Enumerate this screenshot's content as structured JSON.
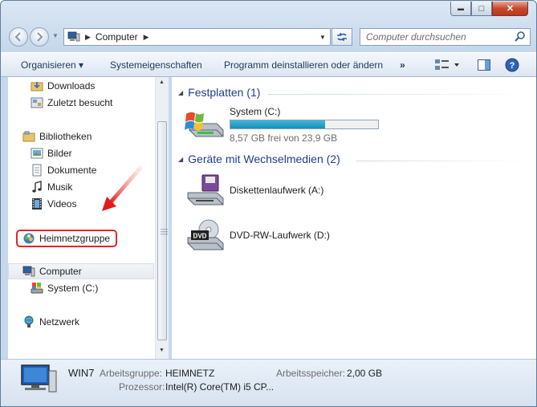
{
  "titlebar": {
    "min_glyph": "▬",
    "max_glyph": "□",
    "close_glyph": "✕"
  },
  "address": {
    "path": "Computer",
    "search_placeholder": "Computer durchsuchen"
  },
  "toolbar": {
    "organize": "Organisieren ▾",
    "properties": "Systemeigenschaften",
    "uninstall": "Programm deinstallieren oder ändern",
    "more": "»"
  },
  "sidebar": {
    "downloads": "Downloads",
    "recent": "Zuletzt besucht",
    "libraries": "Bibliotheken",
    "pictures": "Bilder",
    "documents": "Dokumente",
    "music": "Musik",
    "videos": "Videos",
    "homegroup": "Heimnetzgruppe",
    "computer": "Computer",
    "system_c": "System (C:)",
    "network": "Netzwerk"
  },
  "content": {
    "group_hdd": "Festplatten (1)",
    "group_removable": "Geräte mit Wechselmedien (2)",
    "drive_c_name": "System (C:)",
    "drive_c_free": "8,57 GB frei von 23,9 GB",
    "drive_c_used_fraction": 0.64,
    "floppy_name": "Diskettenlaufwerk (A:)",
    "dvd_name": "DVD-RW-Laufwerk (D:)",
    "dvd_badge": "DVD"
  },
  "details": {
    "computer_name": "WIN7",
    "workgroup_label": "Arbeitsgruppe:",
    "workgroup_value": "HEIMNETZ",
    "memory_label": "Arbeitsspeicher:",
    "memory_value": "2,00 GB",
    "cpu_label": "Prozessor:",
    "cpu_value": "Intel(R) Core(TM) i5 CP..."
  },
  "colors": {
    "accent": "#1e3f8a",
    "highlight": "#e32626",
    "usage_bar": "#2aa6cf"
  }
}
